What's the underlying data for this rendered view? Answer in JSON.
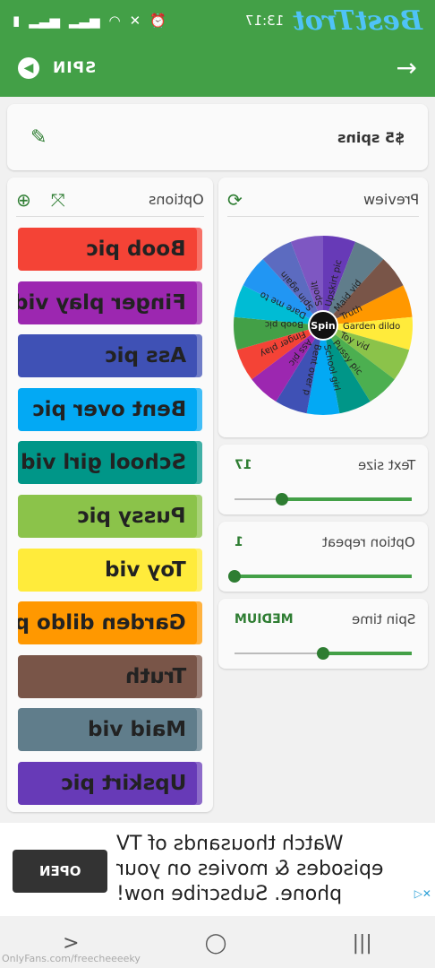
{
  "status": {
    "time": "13:17"
  },
  "logo": "BestTrot",
  "toolbar": {
    "title": "SPIN"
  },
  "spin_name": "$5 spins",
  "options": {
    "label": "Options",
    "items": [
      {
        "label": "Boob pic",
        "color": "#f44336"
      },
      {
        "label": "Finger play vid",
        "color": "#9c27b0"
      },
      {
        "label": "Ass pic",
        "color": "#3f51b5"
      },
      {
        "label": "Bent over pic",
        "color": "#03a9f4"
      },
      {
        "label": "School girl vid",
        "color": "#009688"
      },
      {
        "label": "Pussy pic",
        "color": "#8bc34a"
      },
      {
        "label": "Toy vid",
        "color": "#ffeb3b"
      },
      {
        "label": "Garden dildo pic",
        "color": "#ff9800"
      },
      {
        "label": "Truth",
        "color": "#795548"
      },
      {
        "label": "Maid vid",
        "color": "#607d8b"
      },
      {
        "label": "Upskirt pic",
        "color": "#673ab7"
      }
    ]
  },
  "preview": {
    "label": "Preview",
    "wheel_center": "Spin",
    "wheel_labels": [
      "Upskirt pic",
      "Maid vid",
      "Truth",
      "Garden dildo",
      "Toy vid",
      "Pussy pic",
      "School girl",
      "Bent over p",
      "Ass pic",
      "Finger play",
      "Boob pic",
      "Dare me to",
      "Spin again",
      "Spoilt"
    ],
    "wheel_colors": [
      "#673ab7",
      "#607d8b",
      "#795548",
      "#ff9800",
      "#ffeb3b",
      "#8bc34a",
      "#4caf50",
      "#009688",
      "#03a9f4",
      "#3f51b5",
      "#9c27b0",
      "#f44336",
      "#43a047",
      "#00bcd4",
      "#2196f3",
      "#5c6bc0",
      "#7e57c2"
    ]
  },
  "settings": {
    "text_size": {
      "label": "Text size",
      "value": "17",
      "level": 0.73
    },
    "option_repeat": {
      "label": "Option repeat",
      "value": "1",
      "level": 1.0
    },
    "spin_time": {
      "label": "Spin time",
      "value": "MEDIUM",
      "level": 0.5
    }
  },
  "ad": {
    "line1": "Watch thousands of TV",
    "line2": "episodes & movies on your",
    "line3": "phone. Subscribe now!",
    "button": "OPEN"
  },
  "watermark": "OnlyFans.com/freecheeeeky"
}
